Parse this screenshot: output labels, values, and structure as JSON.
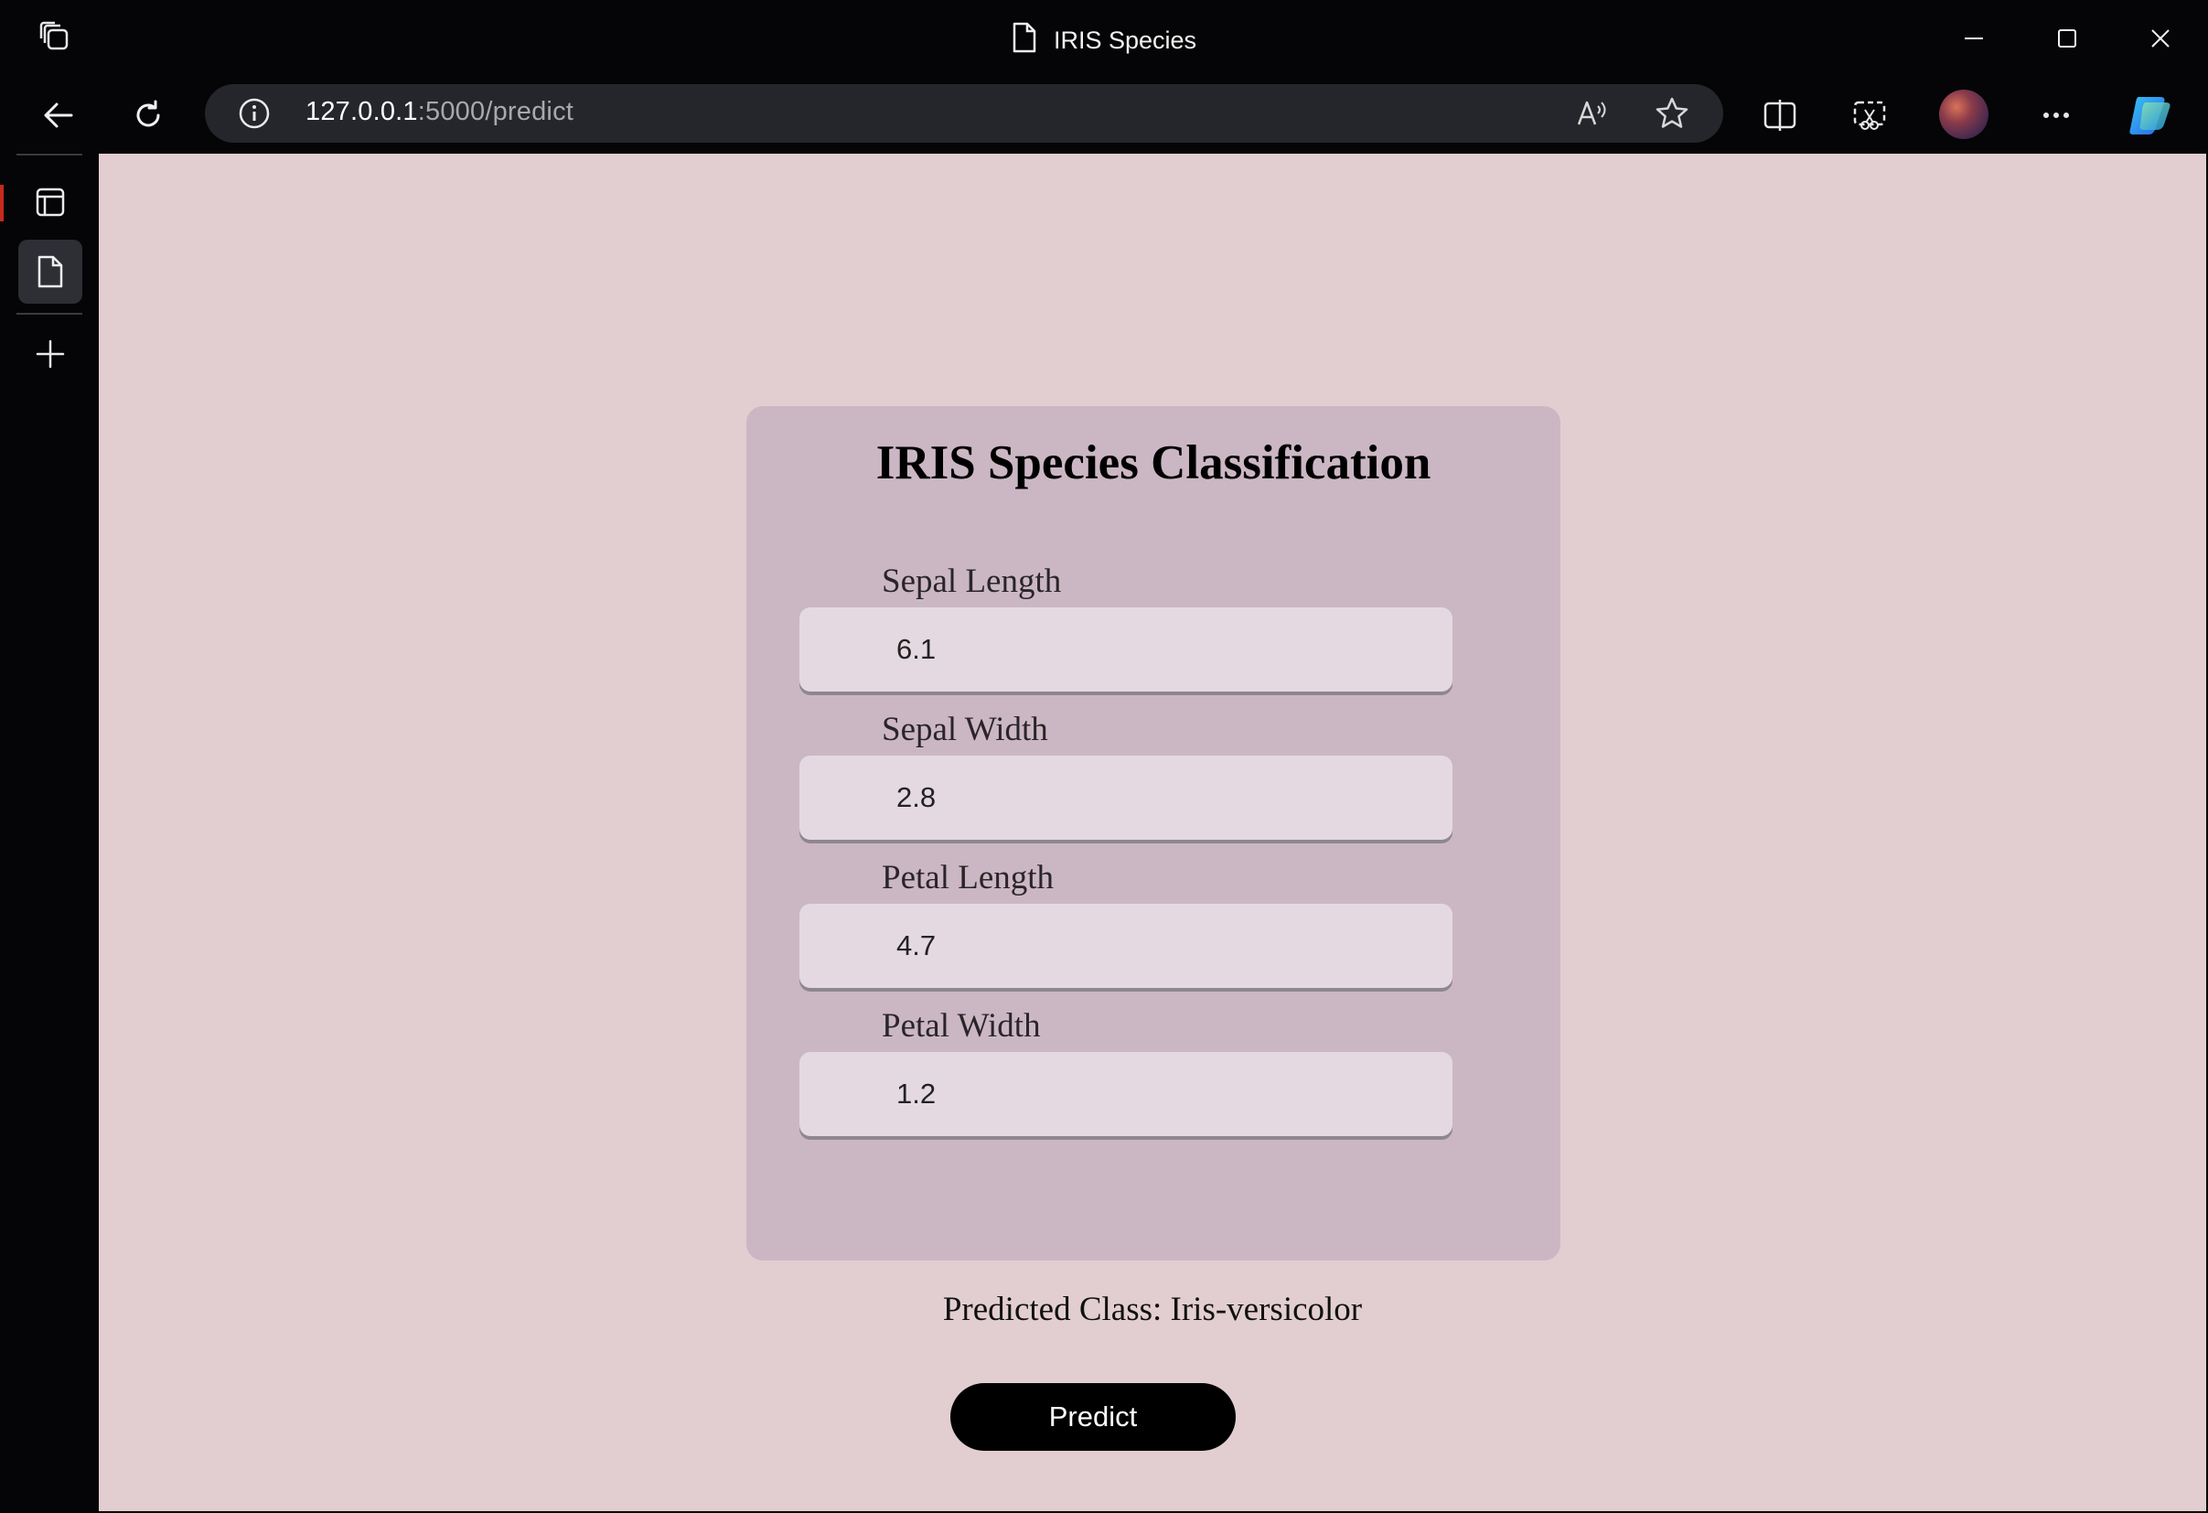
{
  "browser": {
    "tab_title": "IRIS Species",
    "url_host": "127.0.0.1",
    "url_rest": ":5000/predict",
    "icons": {
      "app": "workspaces-icon",
      "back": "back-arrow-icon",
      "reload": "reload-icon",
      "info": "info-icon",
      "read_aloud": "read-aloud-icon",
      "favorite": "star-icon",
      "split": "split-screen-icon",
      "screenshot": "screenshot-icon",
      "profile": "avatar",
      "more": "more-icon",
      "copilot": "copilot-icon"
    }
  },
  "sidebar": {
    "items": [
      "tab-actions",
      "current-page",
      "new-tab"
    ]
  },
  "page": {
    "title": "IRIS Species Classification",
    "fields": [
      {
        "label": "Sepal Length",
        "value": "6.1"
      },
      {
        "label": "Sepal Width",
        "value": "2.8"
      },
      {
        "label": "Petal Length",
        "value": "4.7"
      },
      {
        "label": "Petal Width",
        "value": "1.2"
      }
    ],
    "result": "Predicted Class: Iris-versicolor",
    "button_label": "Predict"
  },
  "colors": {
    "page_bg": "#e2ced1",
    "card_bg": "#cbb7c3",
    "input_bg": "#e4d9e0",
    "button_bg": "#000000"
  }
}
